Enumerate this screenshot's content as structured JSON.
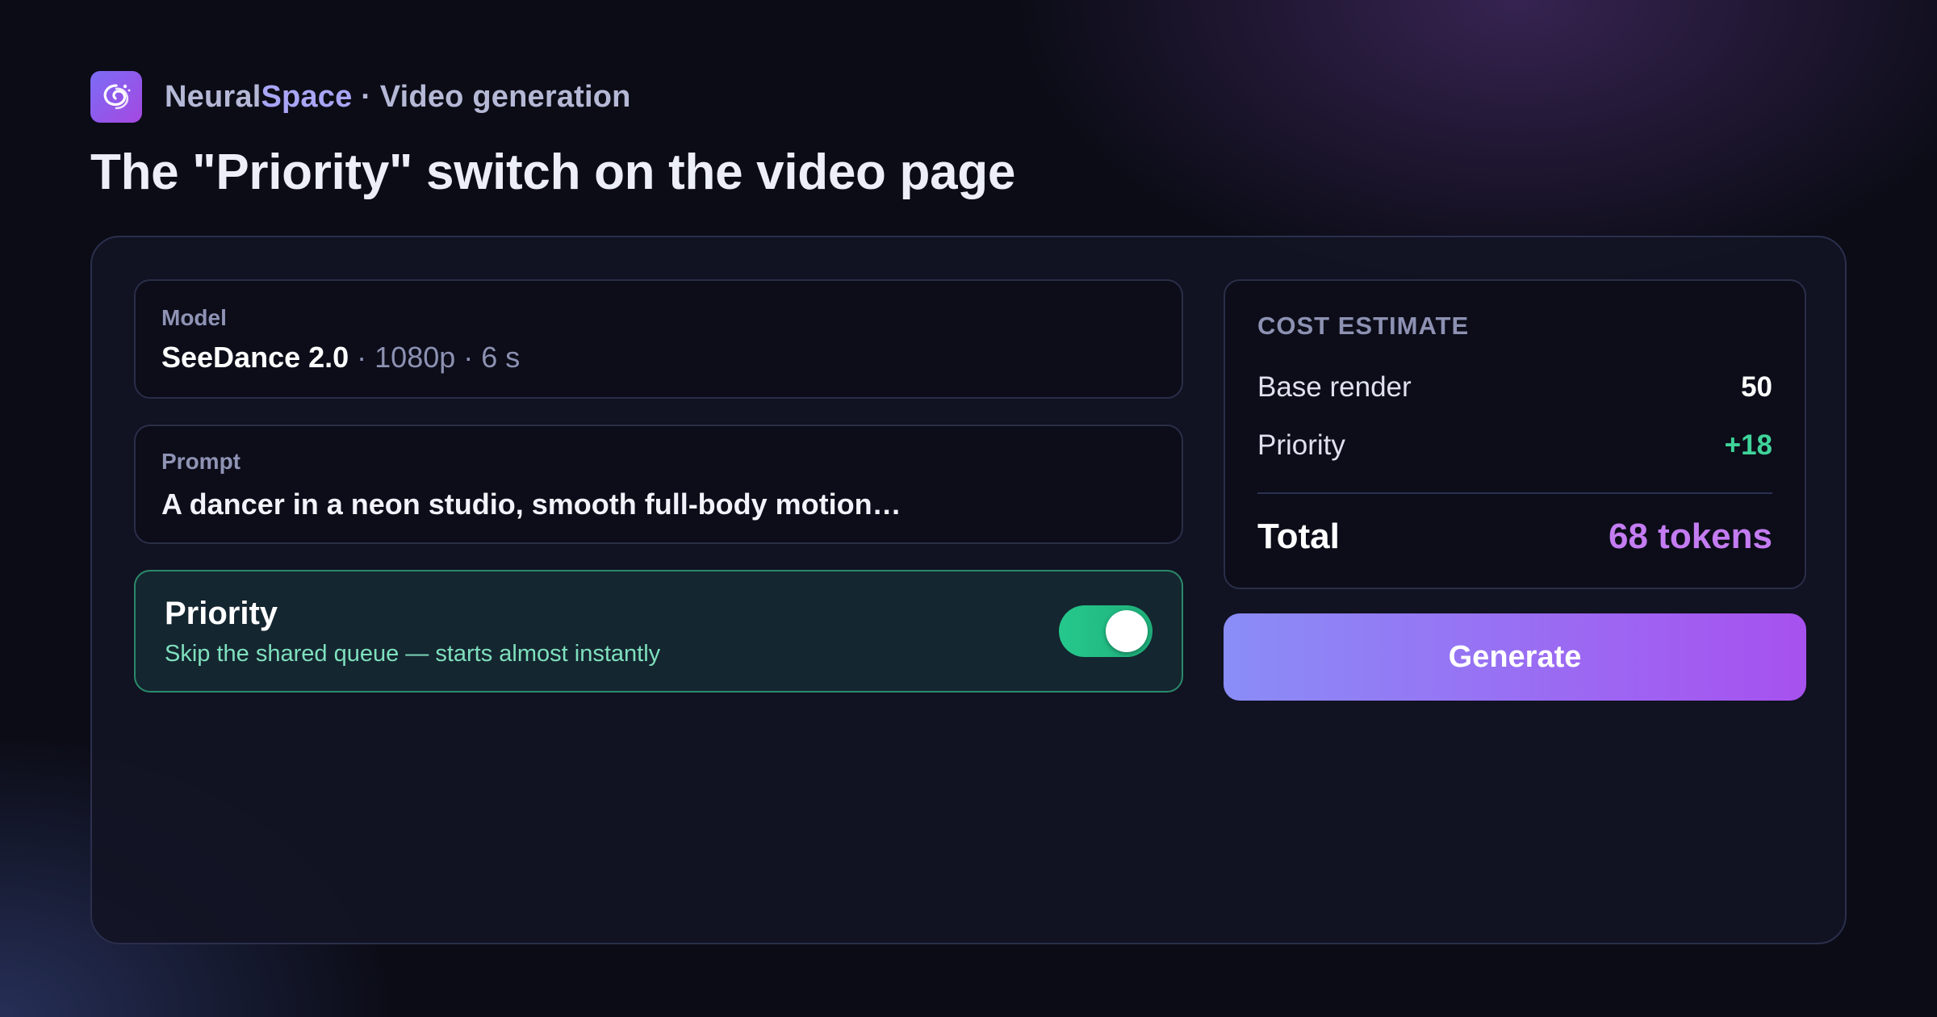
{
  "brand": {
    "name_part1": "Neural",
    "name_part2": "Space",
    "section": " · Video generation",
    "logo_icon": "galaxy-swirl-icon"
  },
  "page_title": "The \"Priority\" switch on the video page",
  "model": {
    "label": "Model",
    "name": "SeeDance 2.0",
    "meta": " · 1080p · 6 s"
  },
  "prompt": {
    "label": "Prompt",
    "text": "A dancer in a neon studio, smooth full-body motion…"
  },
  "priority": {
    "title": "Priority",
    "description": "Skip the shared queue — starts almost instantly",
    "enabled": true
  },
  "cost": {
    "heading": "COST ESTIMATE",
    "rows": [
      {
        "label": "Base render",
        "value": "50"
      },
      {
        "label": "Priority",
        "value": "+18"
      }
    ],
    "total_label": "Total",
    "total_value": "68 tokens"
  },
  "generate_label": "Generate",
  "colors": {
    "accent_green": "#25c88c",
    "accent_purple": "#c47cf2",
    "button_gradient_start": "#8a8df7",
    "button_gradient_end": "#a751ef",
    "background": "#0b0c16"
  }
}
